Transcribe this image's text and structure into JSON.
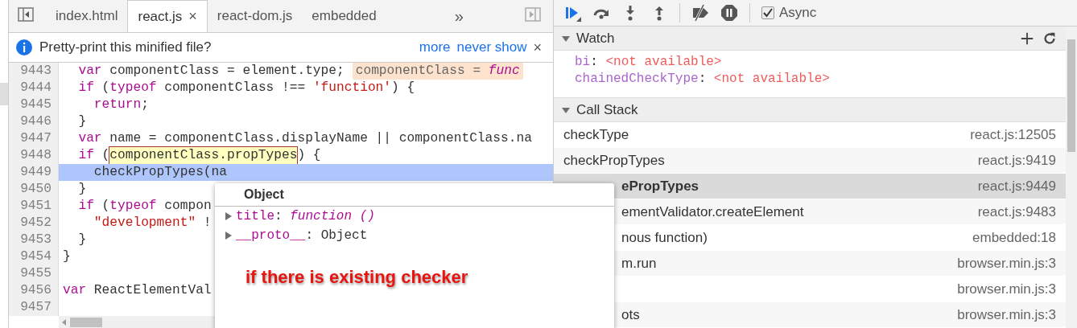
{
  "editor": {
    "tabs": [
      {
        "label": "index.html",
        "selected": false
      },
      {
        "label": "react.js",
        "selected": true,
        "close": "×"
      },
      {
        "label": "react-dom.js",
        "selected": false
      },
      {
        "label": "embedded",
        "selected": false
      }
    ],
    "overflow": "»",
    "infobar": {
      "message": "Pretty-print this minified file?",
      "links": [
        "more",
        "never show"
      ],
      "close": "×"
    },
    "lines": [
      {
        "number": "9443",
        "selected": false,
        "segments": [
          {
            "kind": "keyword",
            "text": "  var"
          },
          {
            "kind": "plain",
            "text": " componentClass = element.type;"
          }
        ],
        "inline_value": [
          {
            "kind": "name",
            "text": "componentClass = "
          },
          {
            "kind": "fn",
            "text": "func"
          }
        ]
      },
      {
        "number": "9444",
        "selected": false,
        "segments": [
          {
            "kind": "keyword",
            "text": "  if"
          },
          {
            "kind": "plain",
            "text": " ("
          },
          {
            "kind": "keyword",
            "text": "typeof"
          },
          {
            "kind": "plain",
            "text": " componentClass !== "
          },
          {
            "kind": "string",
            "text": "'function'"
          },
          {
            "kind": "plain",
            "text": ") {"
          }
        ]
      },
      {
        "number": "9445",
        "selected": false,
        "segments": [
          {
            "kind": "keyword",
            "text": "    return"
          },
          {
            "kind": "plain",
            "text": ";"
          }
        ]
      },
      {
        "number": "9446",
        "selected": false,
        "segments": [
          {
            "kind": "plain",
            "text": "  }"
          }
        ]
      },
      {
        "number": "9447",
        "selected": false,
        "segments": [
          {
            "kind": "keyword",
            "text": "  var"
          },
          {
            "kind": "plain",
            "text": " name = componentClass.displayName || componentClass.na"
          }
        ]
      },
      {
        "number": "9448",
        "selected": false,
        "segments": [
          {
            "kind": "keyword",
            "text": "  if"
          },
          {
            "kind": "plain",
            "text": " ("
          },
          {
            "kind": "match",
            "text": "componentClass.propTypes"
          },
          {
            "kind": "plain",
            "text": ") {"
          }
        ]
      },
      {
        "number": "9449",
        "selected": true,
        "segments": [
          {
            "kind": "plain",
            "text": "    checkPropTypes(na"
          }
        ]
      },
      {
        "number": "9450",
        "selected": false,
        "segments": [
          {
            "kind": "plain",
            "text": "  }"
          }
        ]
      },
      {
        "number": "9451",
        "selected": false,
        "segments": [
          {
            "kind": "keyword",
            "text": "  if"
          },
          {
            "kind": "plain",
            "text": " ("
          },
          {
            "kind": "keyword",
            "text": "typeof"
          },
          {
            "kind": "plain",
            "text": " compon"
          }
        ]
      },
      {
        "number": "9452",
        "selected": false,
        "segments": [
          {
            "kind": "string",
            "text": "    \"development\""
          },
          {
            "kind": "plain",
            "text": " !"
          }
        ]
      },
      {
        "number": "9453",
        "selected": false,
        "segments": [
          {
            "kind": "plain",
            "text": "  }"
          }
        ]
      },
      {
        "number": "9454",
        "selected": false,
        "segments": [
          {
            "kind": "plain",
            "text": "}"
          }
        ]
      },
      {
        "number": "9455",
        "selected": false
      },
      {
        "number": "9456",
        "selected": false,
        "segments": [
          {
            "kind": "keyword",
            "text": "var"
          },
          {
            "kind": "plain",
            "text": " ReactElementVal"
          }
        ]
      },
      {
        "number": "9457",
        "selected": false
      }
    ]
  },
  "popover": {
    "title": "Object",
    "properties": [
      {
        "name": "title",
        "separator": ":",
        "kind": "function",
        "value": "function ()"
      },
      {
        "name": "__proto__",
        "separator": ":",
        "kind": "object",
        "value": "Object"
      }
    ]
  },
  "annotation": "if there is existing checker",
  "debugger": {
    "async": {
      "label": "Async",
      "checked": true
    },
    "watch": {
      "title": "Watch",
      "expanded": true,
      "items": [
        {
          "name": "bi",
          "separator": ":",
          "value": "<not available>"
        },
        {
          "name": "chainedCheckType",
          "separator": ":",
          "value": "<not available>"
        }
      ]
    },
    "call_stack": {
      "title": "Call Stack",
      "expanded": true,
      "frames": [
        {
          "name": "checkType",
          "location": "react.js:12505",
          "selected": false,
          "partly_hidden": false
        },
        {
          "name": "checkPropTypes",
          "location": "react.js:9419",
          "selected": false,
          "partly_hidden": false
        },
        {
          "name": "ePropTypes",
          "location": "react.js:9449",
          "selected": true,
          "partly_hidden": true
        },
        {
          "name": "ementValidator.createElement",
          "location": "react.js:9483",
          "selected": false,
          "partly_hidden": true
        },
        {
          "name": "nous function)",
          "location": "embedded:18",
          "selected": false,
          "partly_hidden": true
        },
        {
          "name": "m.run",
          "location": "browser.min.js:3",
          "selected": false,
          "partly_hidden": true
        },
        {
          "location": "browser.min.js:3",
          "selected": false
        },
        {
          "name": "ots",
          "location": "browser.min.js:3",
          "selected": false,
          "partly_hidden": true
        }
      ]
    }
  }
}
